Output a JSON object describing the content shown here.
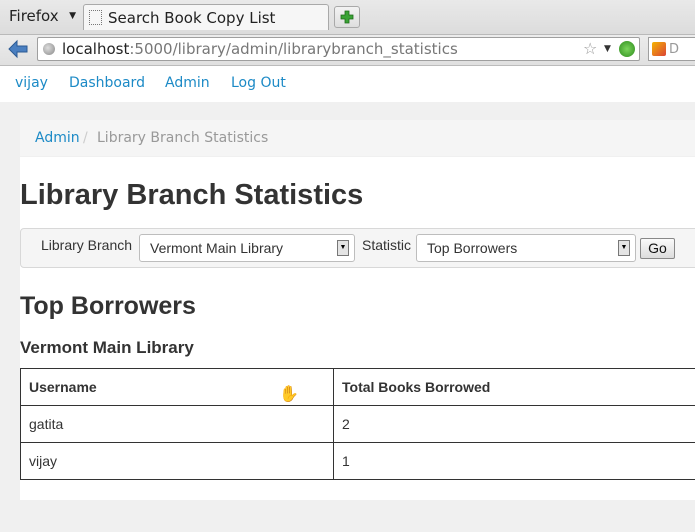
{
  "browser": {
    "app_menu_label": "Firefox",
    "tab_title": "Search Book Copy List",
    "new_tab_label": "+",
    "url_host": "localhost",
    "url_rest": ":5000/library/admin/librarybranch_statistics",
    "search_placeholder": "D"
  },
  "topnav": {
    "user": "vijay",
    "dashboard": "Dashboard",
    "admin": "Admin",
    "logout": "Log Out"
  },
  "breadcrumb": {
    "root": "Admin",
    "separator": "/",
    "current": "Library Branch Statistics"
  },
  "page_title": "Library Branch Statistics",
  "filters": {
    "branch_label": "Library Branch",
    "branch_value": "Vermont Main Library",
    "statistic_label": "Statistic",
    "statistic_value": "Top Borrowers",
    "go_label": "Go"
  },
  "results": {
    "section_title": "Top Borrowers",
    "branch_title": "Vermont Main Library",
    "columns": [
      "Username",
      "Total Books Borrowed"
    ],
    "rows": [
      [
        "gatita",
        "2"
      ],
      [
        "vijay",
        "1"
      ]
    ]
  },
  "colors": {
    "link": "#1c8ac6",
    "text": "#333333"
  }
}
